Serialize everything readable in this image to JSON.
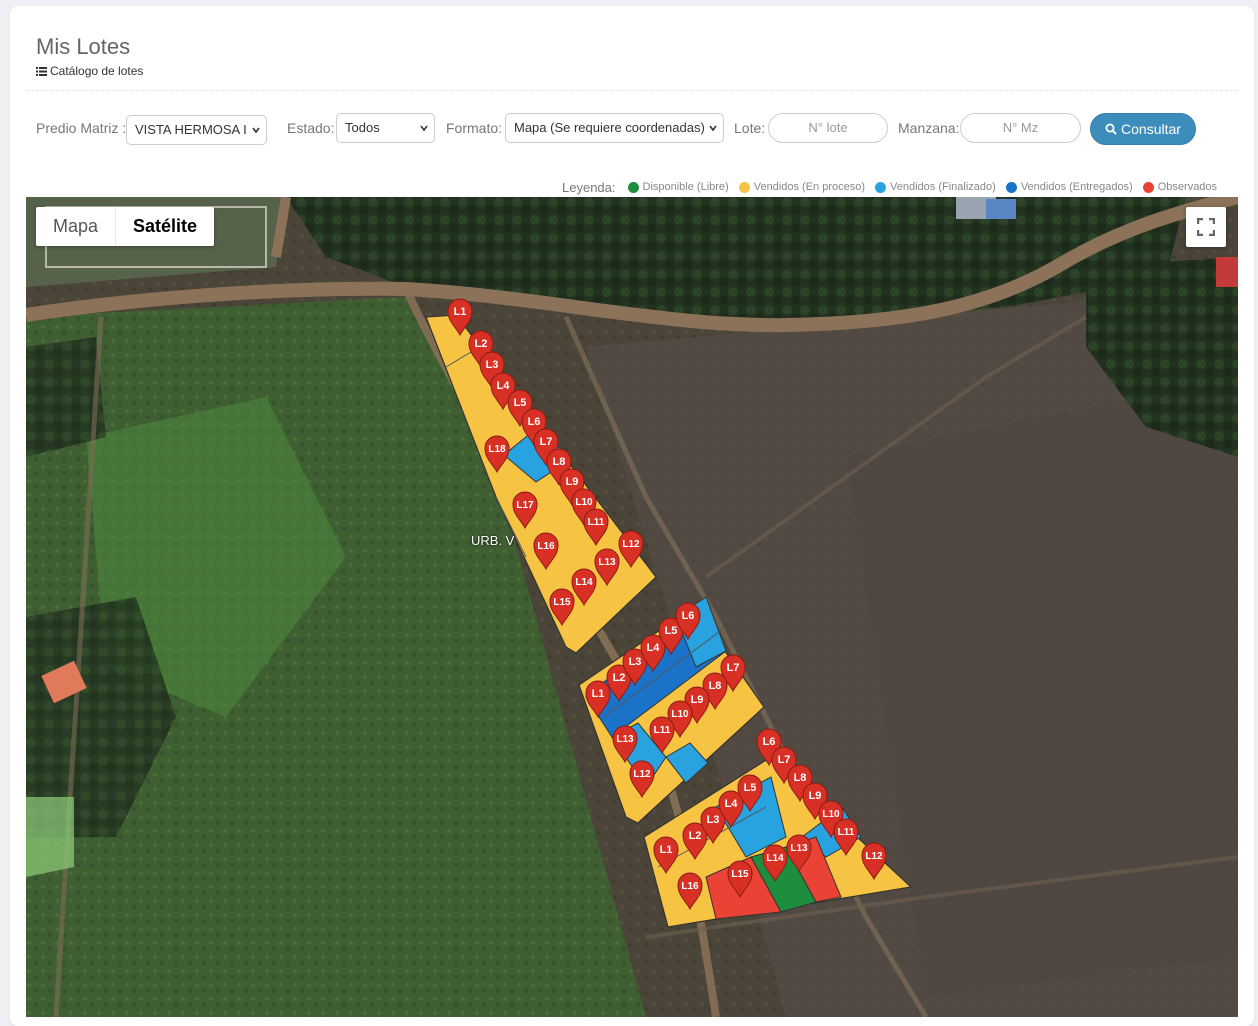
{
  "page": {
    "title": "Mis Lotes",
    "breadcrumb": "Catálogo de lotes"
  },
  "filters": {
    "predio_label": "Predio Matriz :",
    "predio_value": "VISTA HERMOSA I",
    "estado_label": "Estado:",
    "estado_value": "Todos",
    "formato_label": "Formato:",
    "formato_value": "Mapa (Se requiere coordenadas)",
    "lote_label": "Lote:",
    "lote_placeholder": "N° lote",
    "manzana_label": "Manzana:",
    "manzana_placeholder": "N° Mz",
    "consultar_label": "Consultar"
  },
  "legend": {
    "title": "Leyenda:",
    "items": [
      {
        "label": "Disponible (Libre)",
        "color": "#1e8e3e"
      },
      {
        "label": "Vendidos (En proceso)",
        "color": "#f6c343"
      },
      {
        "label": "Vendidos (Finalizado)",
        "color": "#29a3e0"
      },
      {
        "label": "Vendidos (Entregados)",
        "color": "#1a73c8"
      },
      {
        "label": "Observados",
        "color": "#ea4335"
      }
    ]
  },
  "map": {
    "type_buttons": [
      "Mapa",
      "Satélite"
    ],
    "active_type": "Satélite",
    "overlay_label": "URB. V",
    "fullscreen_icon": "fullscreen-icon"
  },
  "blocks": [
    {
      "name": "block-1",
      "markers": [
        "L1",
        "L2",
        "L3",
        "L4",
        "L5",
        "L6",
        "L7",
        "L8",
        "L9",
        "L10",
        "L11",
        "L12",
        "L13",
        "L14",
        "L15",
        "L16",
        "L17",
        "L18"
      ]
    },
    {
      "name": "block-2",
      "markers": [
        "L1",
        "L2",
        "L3",
        "L4",
        "L5",
        "L6",
        "L7",
        "L8",
        "L9",
        "L10",
        "L11",
        "L12",
        "L13"
      ]
    },
    {
      "name": "block-3",
      "markers": [
        "L1",
        "L2",
        "L3",
        "L4",
        "L5",
        "L6",
        "L7",
        "L8",
        "L9",
        "L10",
        "L11",
        "L12",
        "L13",
        "L14",
        "L15",
        "L16"
      ]
    }
  ]
}
